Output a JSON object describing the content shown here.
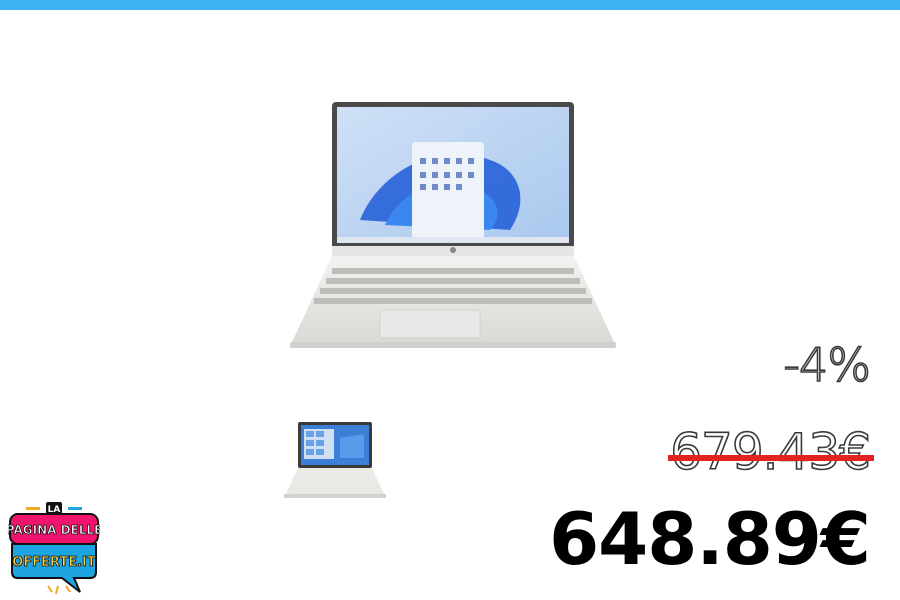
{
  "colors": {
    "top_bar": "#3bb3f5",
    "strike": "#e32222",
    "price_text": "#000000",
    "logo_pink": "#f0146e",
    "logo_blue": "#1ea4e0",
    "logo_orange": "#f5a623"
  },
  "product": {
    "main_image_icon": "laptop-icon",
    "thumbnail_icon": "laptop-icon"
  },
  "pricing": {
    "discount": "-4%",
    "old_price": "679.43€",
    "new_price": "648.89€"
  },
  "logo": {
    "line1": "LA",
    "line2": "PAGINA DELLE",
    "line3": "OFFERTE.IT"
  }
}
